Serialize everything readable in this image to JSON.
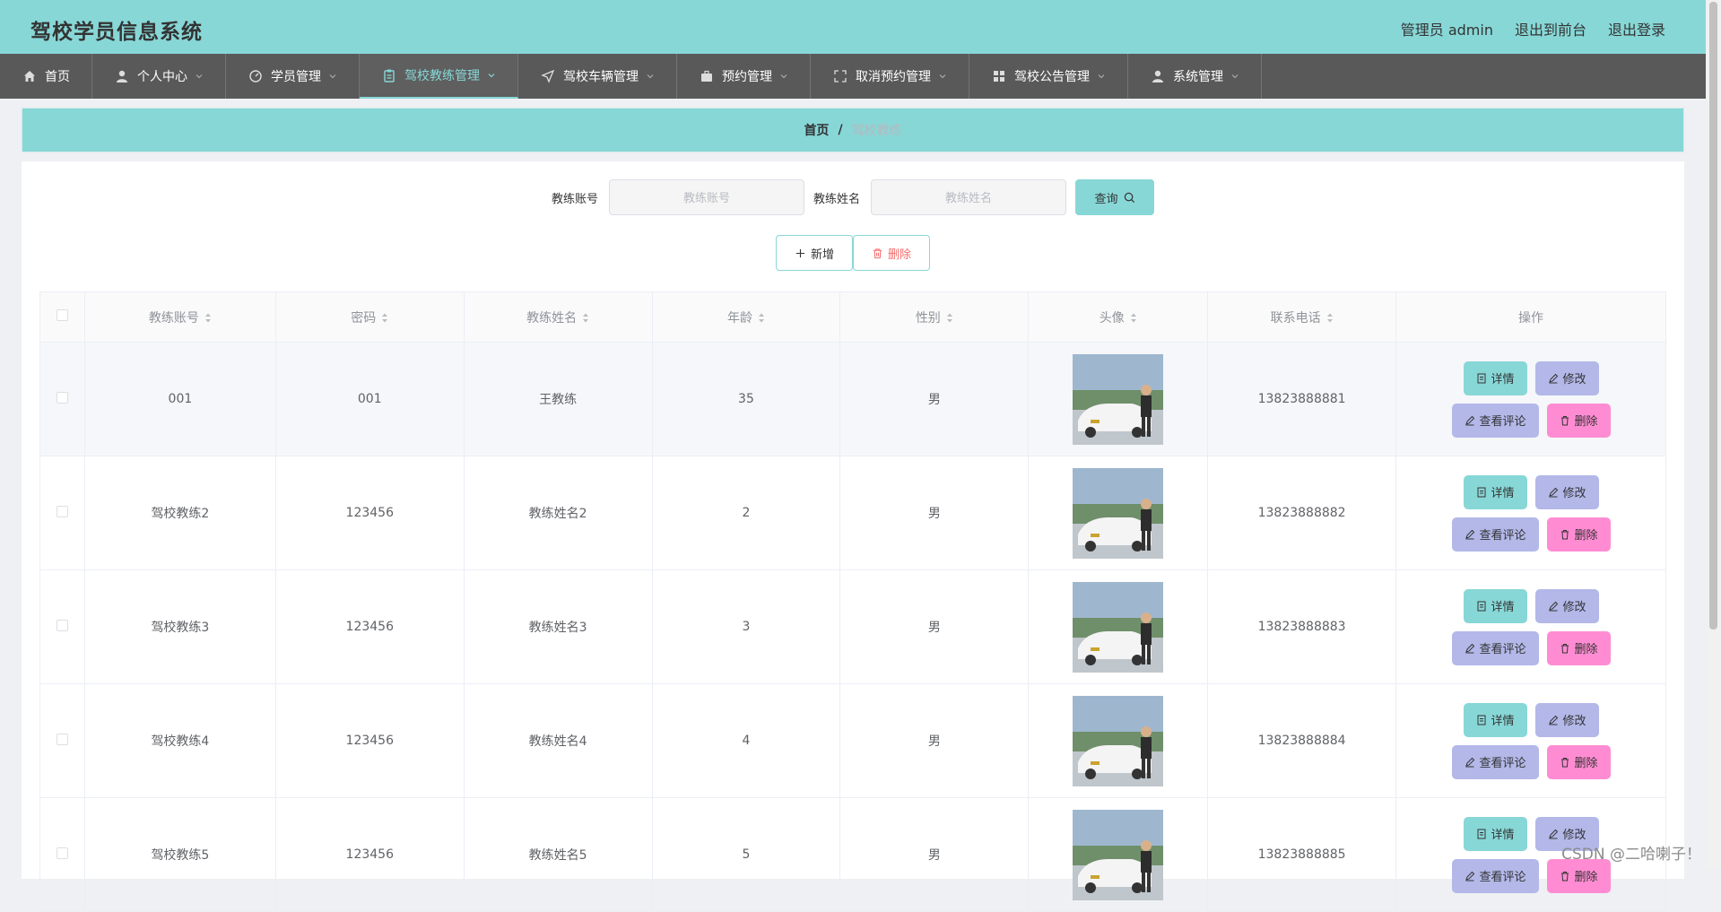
{
  "header": {
    "title": "驾校学员信息系统",
    "admin_label": "管理员 admin",
    "front_label": "退出到前台",
    "logout_label": "退出登录"
  },
  "nav": [
    {
      "label": "首页",
      "icon": "home-icon"
    },
    {
      "label": "个人中心",
      "icon": "user-icon"
    },
    {
      "label": "学员管理",
      "icon": "speedometer-icon"
    },
    {
      "label": "驾校教练管理",
      "icon": "clipboard-icon"
    },
    {
      "label": "驾校车辆管理",
      "icon": "location-arrow-icon"
    },
    {
      "label": "预约管理",
      "icon": "briefcase-icon"
    },
    {
      "label": "取消预约管理",
      "icon": "fullscreen-icon"
    },
    {
      "label": "驾校公告管理",
      "icon": "grid-icon"
    },
    {
      "label": "系统管理",
      "icon": "user-icon"
    }
  ],
  "breadcrumb": {
    "home": "首页",
    "separator": "/",
    "current": "驾校教练"
  },
  "search": {
    "account_label": "教练账号",
    "account_placeholder": "教练账号",
    "name_label": "教练姓名",
    "name_placeholder": "教练姓名",
    "query_label": "查询"
  },
  "actions": {
    "add_label": "新增",
    "delete_label": "删除"
  },
  "table": {
    "columns": [
      "教练账号",
      "密码",
      "教练姓名",
      "年龄",
      "性别",
      "头像",
      "联系电话",
      "操作"
    ],
    "rows": [
      {
        "account": "001",
        "password": "001",
        "name": "王教练",
        "age": "35",
        "gender": "男",
        "phone": "13823888881"
      },
      {
        "account": "驾校教练2",
        "password": "123456",
        "name": "教练姓名2",
        "age": "2",
        "gender": "男",
        "phone": "13823888882"
      },
      {
        "account": "驾校教练3",
        "password": "123456",
        "name": "教练姓名3",
        "age": "3",
        "gender": "男",
        "phone": "13823888883"
      },
      {
        "account": "驾校教练4",
        "password": "123456",
        "name": "教练姓名4",
        "age": "4",
        "gender": "男",
        "phone": "13823888884"
      },
      {
        "account": "驾校教练5",
        "password": "123456",
        "name": "教练姓名5",
        "age": "5",
        "gender": "男",
        "phone": "13823888885"
      }
    ],
    "op_labels": {
      "detail": "详情",
      "edit": "修改",
      "comment": "查看评论",
      "delete": "删除"
    }
  },
  "watermark": "CSDN @二哈喇子！",
  "colors": {
    "accent": "#88d7d7",
    "nav_bg": "#595959",
    "edit": "#b3b8e9",
    "delete": "#ff8cd3"
  }
}
